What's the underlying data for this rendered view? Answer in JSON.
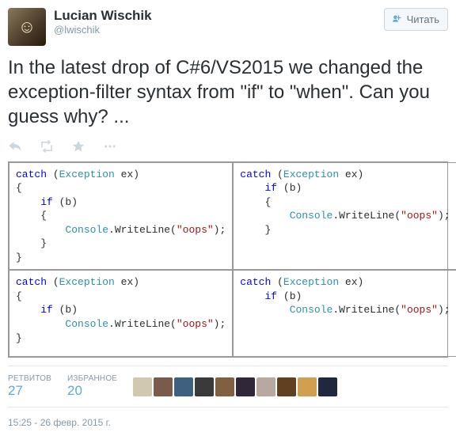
{
  "author": {
    "display_name": "Lucian Wischik",
    "handle": "@lwischik"
  },
  "follow_button_label": "Читать",
  "tweet_text": "In the latest drop of C#6/VS2015 we changed the exception-filter syntax from \"if\" to \"when\". Can you guess why? ...",
  "code": {
    "top_left": [
      {
        "t": "kw",
        "v": "catch"
      },
      {
        "t": "p",
        "v": " ("
      },
      {
        "t": "type",
        "v": "Exception"
      },
      {
        "t": "p",
        "v": " ex)\n{\n    "
      },
      {
        "t": "kw",
        "v": "if"
      },
      {
        "t": "p",
        "v": " (b)\n    {\n        "
      },
      {
        "t": "type",
        "v": "Console"
      },
      {
        "t": "p",
        "v": ".WriteLine("
      },
      {
        "t": "str",
        "v": "\"oops\""
      },
      {
        "t": "p",
        "v": ");\n    }\n}"
      }
    ],
    "top_right": [
      {
        "t": "kw",
        "v": "catch"
      },
      {
        "t": "p",
        "v": " ("
      },
      {
        "t": "type",
        "v": "Exception"
      },
      {
        "t": "p",
        "v": " ex)\n    "
      },
      {
        "t": "kw",
        "v": "if"
      },
      {
        "t": "p",
        "v": " (b)\n    {\n        "
      },
      {
        "t": "type",
        "v": "Console"
      },
      {
        "t": "p",
        "v": ".WriteLine("
      },
      {
        "t": "str",
        "v": "\"oops\""
      },
      {
        "t": "p",
        "v": ");\n    }"
      }
    ],
    "bottom_left": [
      {
        "t": "kw",
        "v": "catch"
      },
      {
        "t": "p",
        "v": " ("
      },
      {
        "t": "type",
        "v": "Exception"
      },
      {
        "t": "p",
        "v": " ex)\n{\n    "
      },
      {
        "t": "kw",
        "v": "if"
      },
      {
        "t": "p",
        "v": " (b)\n        "
      },
      {
        "t": "type",
        "v": "Console"
      },
      {
        "t": "p",
        "v": ".WriteLine("
      },
      {
        "t": "str",
        "v": "\"oops\""
      },
      {
        "t": "p",
        "v": ");\n}"
      }
    ],
    "bottom_right": [
      {
        "t": "kw",
        "v": "catch"
      },
      {
        "t": "p",
        "v": " ("
      },
      {
        "t": "type",
        "v": "Exception"
      },
      {
        "t": "p",
        "v": " ex)\n    "
      },
      {
        "t": "kw",
        "v": "if"
      },
      {
        "t": "p",
        "v": " (b)\n        "
      },
      {
        "t": "type",
        "v": "Console"
      },
      {
        "t": "p",
        "v": ".WriteLine("
      },
      {
        "t": "str",
        "v": "\"oops\""
      },
      {
        "t": "p",
        "v": ");"
      }
    ]
  },
  "stats": {
    "retweets_label": "РЕТВИТОВ",
    "retweets_value": "27",
    "favorites_label": "ИЗБРАННОЕ",
    "favorites_value": "20"
  },
  "face_colors": [
    "#d0c8b0",
    "#7a5a4a",
    "#406080",
    "#3a3a3a",
    "#806040",
    "#302838",
    "#b8a8a0",
    "#604020",
    "#d0a050",
    "#202840"
  ],
  "timestamp": "15:25 - 26 февр. 2015 г."
}
